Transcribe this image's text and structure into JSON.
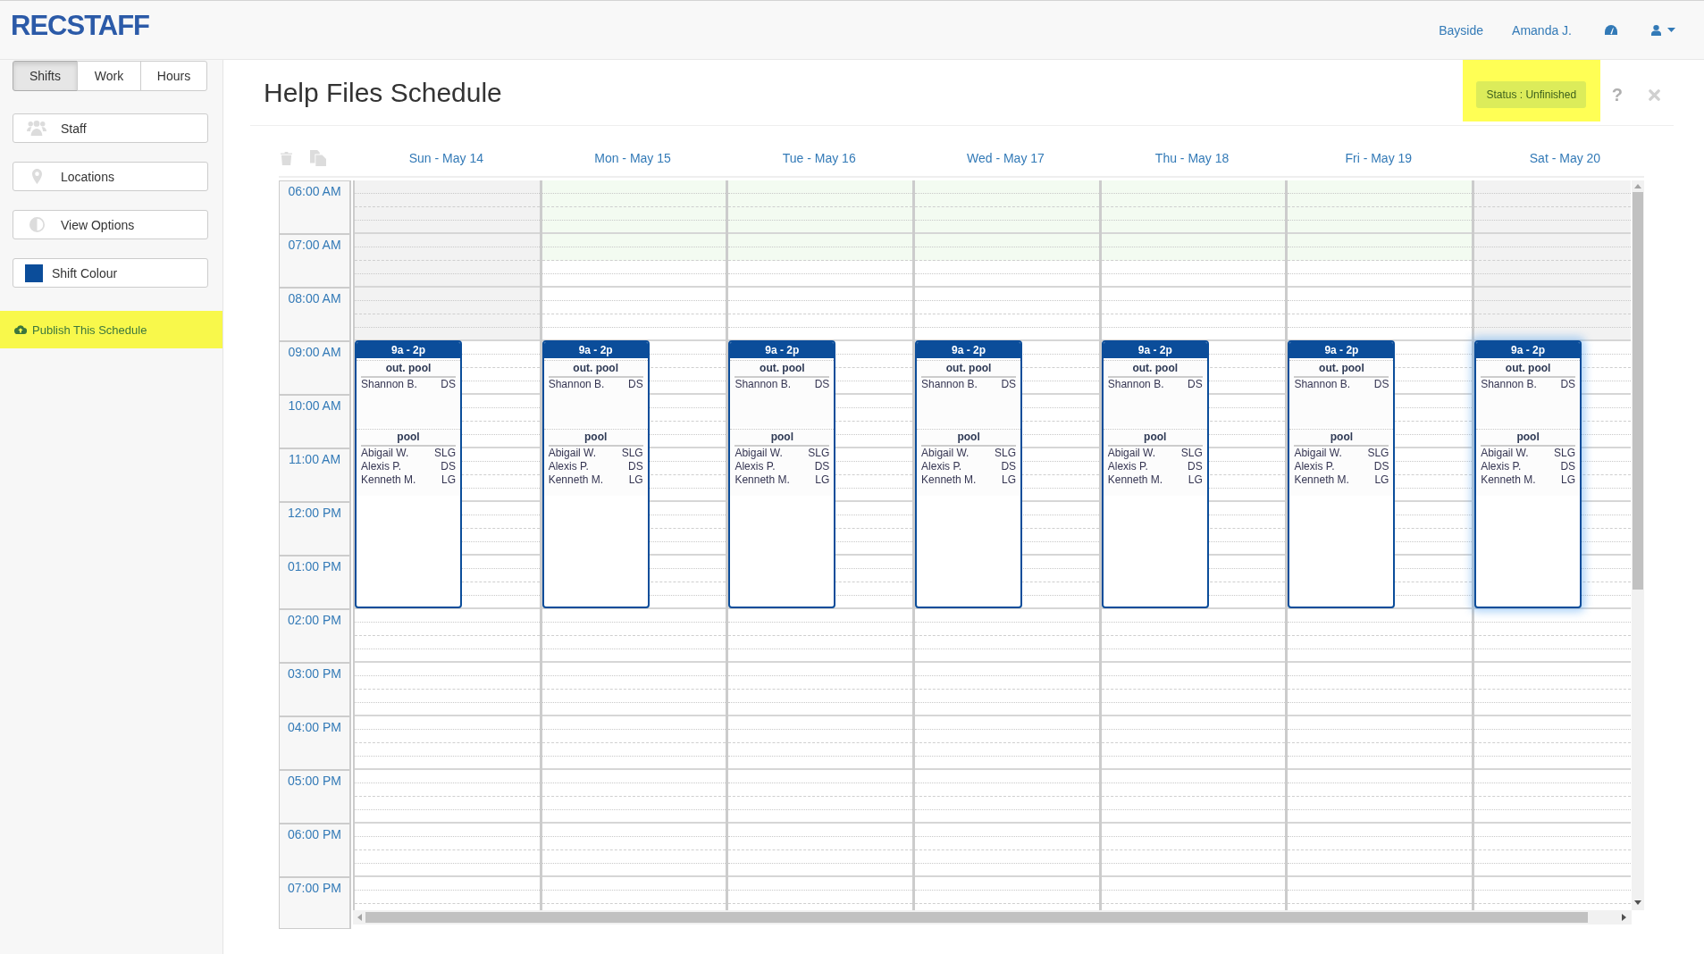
{
  "header": {
    "logo": "RECSTAFF",
    "links": [
      "Bayside",
      "Amanda J."
    ]
  },
  "sidebar": {
    "tabs": [
      {
        "label": "Shifts",
        "selected": true
      },
      {
        "label": "Work",
        "selected": false
      },
      {
        "label": "Hours",
        "selected": false
      }
    ],
    "items": [
      {
        "kind": "icon",
        "label": "Staff"
      },
      {
        "kind": "icon",
        "label": "Locations"
      },
      {
        "kind": "icon",
        "label": "View Options"
      },
      {
        "kind": "swatch",
        "label": "Shift Colour",
        "color": "#0b4d9a"
      }
    ],
    "publish": "Publish This Schedule"
  },
  "page": {
    "title": "Help Files Schedule",
    "status": "Status : Unfinished",
    "help": "?"
  },
  "schedule": {
    "times": [
      "06:00 AM",
      "07:00 AM",
      "08:00 AM",
      "09:00 AM",
      "10:00 AM",
      "11:00 AM",
      "12:00 PM",
      "01:00 PM",
      "02:00 PM",
      "03:00 PM",
      "04:00 PM",
      "05:00 PM",
      "06:00 PM",
      "07:00 PM"
    ],
    "days": [
      {
        "label": "Sun - May 14",
        "kind": "weekend",
        "shifts": [
          {
            "time": "9a - 2p",
            "selected": false,
            "locations": [
              {
                "name": "out. pool",
                "staff": [
                  {
                    "name": "Shannon B.",
                    "role": "DS"
                  }
                ]
              },
              {
                "name": "pool",
                "staff": [
                  {
                    "name": "Abigail W.",
                    "role": "SLG"
                  },
                  {
                    "name": "Alexis P.",
                    "role": "DS"
                  },
                  {
                    "name": "Kenneth M.",
                    "role": "LG"
                  }
                ]
              }
            ]
          }
        ]
      },
      {
        "label": "Mon - May 15",
        "kind": "weekday",
        "shifts": [
          {
            "time": "9a - 2p",
            "selected": false,
            "locations": [
              {
                "name": "out. pool",
                "staff": [
                  {
                    "name": "Shannon B.",
                    "role": "DS"
                  }
                ]
              },
              {
                "name": "pool",
                "staff": [
                  {
                    "name": "Abigail W.",
                    "role": "SLG"
                  },
                  {
                    "name": "Alexis P.",
                    "role": "DS"
                  },
                  {
                    "name": "Kenneth M.",
                    "role": "LG"
                  }
                ]
              }
            ]
          }
        ]
      },
      {
        "label": "Tue - May 16",
        "kind": "weekday",
        "shifts": [
          {
            "time": "9a - 2p",
            "selected": false,
            "locations": [
              {
                "name": "out. pool",
                "staff": [
                  {
                    "name": "Shannon B.",
                    "role": "DS"
                  }
                ]
              },
              {
                "name": "pool",
                "staff": [
                  {
                    "name": "Abigail W.",
                    "role": "SLG"
                  },
                  {
                    "name": "Alexis P.",
                    "role": "DS"
                  },
                  {
                    "name": "Kenneth M.",
                    "role": "LG"
                  }
                ]
              }
            ]
          }
        ]
      },
      {
        "label": "Wed - May 17",
        "kind": "weekday",
        "shifts": [
          {
            "time": "9a - 2p",
            "selected": false,
            "locations": [
              {
                "name": "out. pool",
                "staff": [
                  {
                    "name": "Shannon B.",
                    "role": "DS"
                  }
                ]
              },
              {
                "name": "pool",
                "staff": [
                  {
                    "name": "Abigail W.",
                    "role": "SLG"
                  },
                  {
                    "name": "Alexis P.",
                    "role": "DS"
                  },
                  {
                    "name": "Kenneth M.",
                    "role": "LG"
                  }
                ]
              }
            ]
          }
        ]
      },
      {
        "label": "Thu - May 18",
        "kind": "weekday",
        "shifts": [
          {
            "time": "9a - 2p",
            "selected": false,
            "locations": [
              {
                "name": "out. pool",
                "staff": [
                  {
                    "name": "Shannon B.",
                    "role": "DS"
                  }
                ]
              },
              {
                "name": "pool",
                "staff": [
                  {
                    "name": "Abigail W.",
                    "role": "SLG"
                  },
                  {
                    "name": "Alexis P.",
                    "role": "DS"
                  },
                  {
                    "name": "Kenneth M.",
                    "role": "LG"
                  }
                ]
              }
            ]
          }
        ]
      },
      {
        "label": "Fri - May 19",
        "kind": "weekday",
        "shifts": [
          {
            "time": "9a - 2p",
            "selected": false,
            "locations": [
              {
                "name": "out. pool",
                "staff": [
                  {
                    "name": "Shannon B.",
                    "role": "DS"
                  }
                ]
              },
              {
                "name": "pool",
                "staff": [
                  {
                    "name": "Abigail W.",
                    "role": "SLG"
                  },
                  {
                    "name": "Alexis P.",
                    "role": "DS"
                  },
                  {
                    "name": "Kenneth M.",
                    "role": "LG"
                  }
                ]
              }
            ]
          }
        ]
      },
      {
        "label": "Sat - May 20",
        "kind": "weekend",
        "shifts": [
          {
            "time": "9a - 2p",
            "selected": true,
            "locations": [
              {
                "name": "out. pool",
                "staff": [
                  {
                    "name": "Shannon B.",
                    "role": "DS"
                  }
                ]
              },
              {
                "name": "pool",
                "staff": [
                  {
                    "name": "Abigail W.",
                    "role": "SLG"
                  },
                  {
                    "name": "Alexis P.",
                    "role": "DS"
                  },
                  {
                    "name": "Kenneth M.",
                    "role": "LG"
                  }
                ]
              }
            ]
          }
        ]
      }
    ]
  }
}
